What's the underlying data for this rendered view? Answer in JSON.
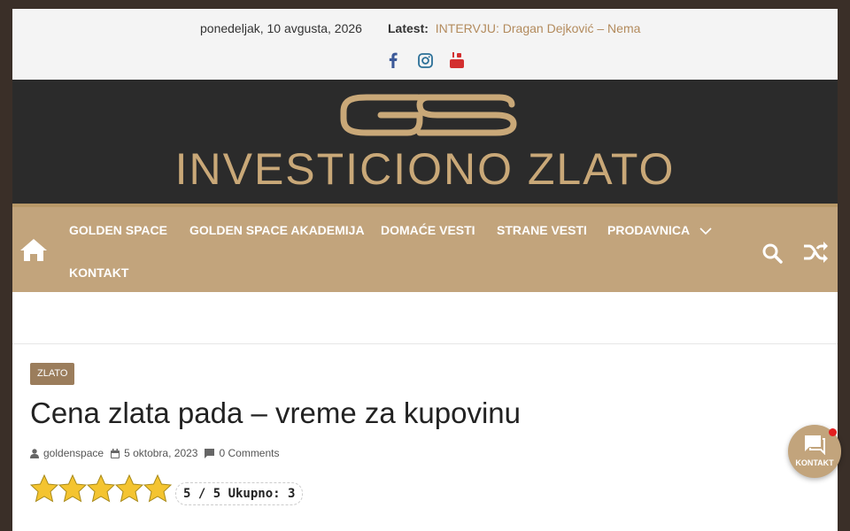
{
  "topbar": {
    "date": "ponedeljak, 10 avgusta, 2026",
    "latest_label": "Latest:",
    "latest_link": "INTERVJU: Dragan Dejković – Nema"
  },
  "social": [
    "facebook-icon",
    "instagram-icon",
    "youtube-icon"
  ],
  "header": {
    "logo_text": "INVESTICIONO ZLATO"
  },
  "nav": {
    "items": [
      "GOLDEN SPACE",
      "GOLDEN SPACE AKADEMIJA",
      "DOMAĆE VESTI",
      "STRANE VESTI",
      "PRODAVNICA",
      "KONTAKT"
    ]
  },
  "article": {
    "category": "ZLATO",
    "title": "Cena zlata pada – vreme za kupovinu",
    "author": "goldenspace",
    "date": "5 oktobra, 2023",
    "comments": "0 Comments",
    "rating_text": "5 / 5 Ukupno: 3",
    "stars": 5
  },
  "fab": {
    "label": "KONTAKT"
  },
  "colors": {
    "accent": "#c2a47c",
    "banner": "#2b2b2b",
    "link": "#b38b5d"
  }
}
